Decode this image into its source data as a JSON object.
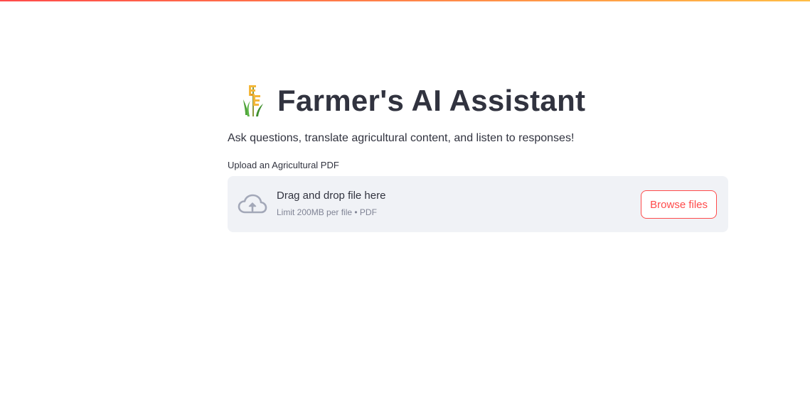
{
  "header": {
    "title": "Farmer's AI Assistant",
    "title_icon": "corn-plant-icon",
    "subtitle": "Ask questions, translate agricultural content, and listen to responses!"
  },
  "uploader": {
    "label": "Upload an Agricultural PDF",
    "icon": "cloud-upload-icon",
    "drop_text": "Drag and drop file here",
    "limit_text": "Limit 200MB per file • PDF",
    "browse_label": "Browse files"
  },
  "colors": {
    "accent": "#ff4b4b",
    "accent_secondary": "#ffbd45",
    "text": "#31333f",
    "muted_text": "#808495",
    "dropzone_bg": "#f0f2f6",
    "icon_gray": "#a3a8b8"
  }
}
